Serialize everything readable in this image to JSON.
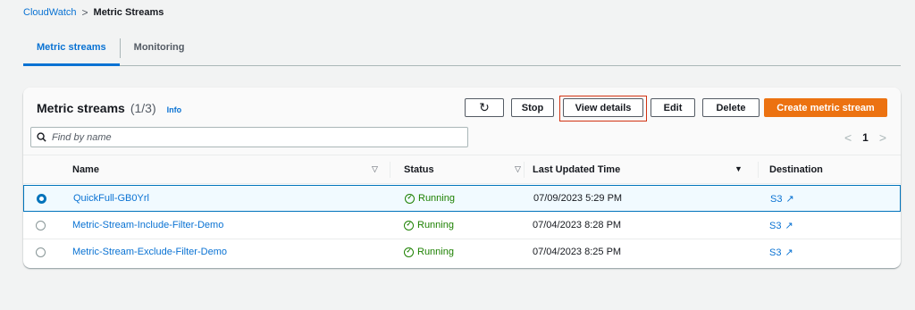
{
  "breadcrumb": {
    "root": "CloudWatch",
    "separator": ">",
    "current": "Metric Streams"
  },
  "tabs": [
    {
      "label": "Metric streams",
      "active": true
    },
    {
      "label": "Monitoring",
      "active": false
    }
  ],
  "panel": {
    "title": "Metric streams",
    "count": "(1/3)",
    "info": "Info",
    "buttons": {
      "refresh": "C",
      "stop": "Stop",
      "view_details": "View details",
      "edit": "Edit",
      "delete": "Delete",
      "create": "Create metric stream"
    },
    "search": {
      "placeholder": "Find by name",
      "icon": "search-icon"
    },
    "pagination": {
      "prev": "<",
      "page": "1",
      "next": ">"
    }
  },
  "table": {
    "columns": [
      "Name",
      "Status",
      "Last Updated Time",
      "Destination"
    ],
    "rows": [
      {
        "name": "QuickFull-GB0Yrl",
        "status": "Running",
        "updated": "07/09/2023 5:29 PM",
        "destination": "S3",
        "selected": true
      },
      {
        "name": "Metric-Stream-Include-Filter-Demo",
        "status": "Running",
        "updated": "07/04/2023 8:28 PM",
        "destination": "S3",
        "selected": false
      },
      {
        "name": "Metric-Stream-Exclude-Filter-Demo",
        "status": "Running",
        "updated": "07/04/2023 8:25 PM",
        "destination": "S3",
        "selected": false
      }
    ]
  },
  "colors": {
    "accent": "#0972d3",
    "primary_button": "#ec7211",
    "success": "#1d8102",
    "highlight": "#d13212"
  }
}
